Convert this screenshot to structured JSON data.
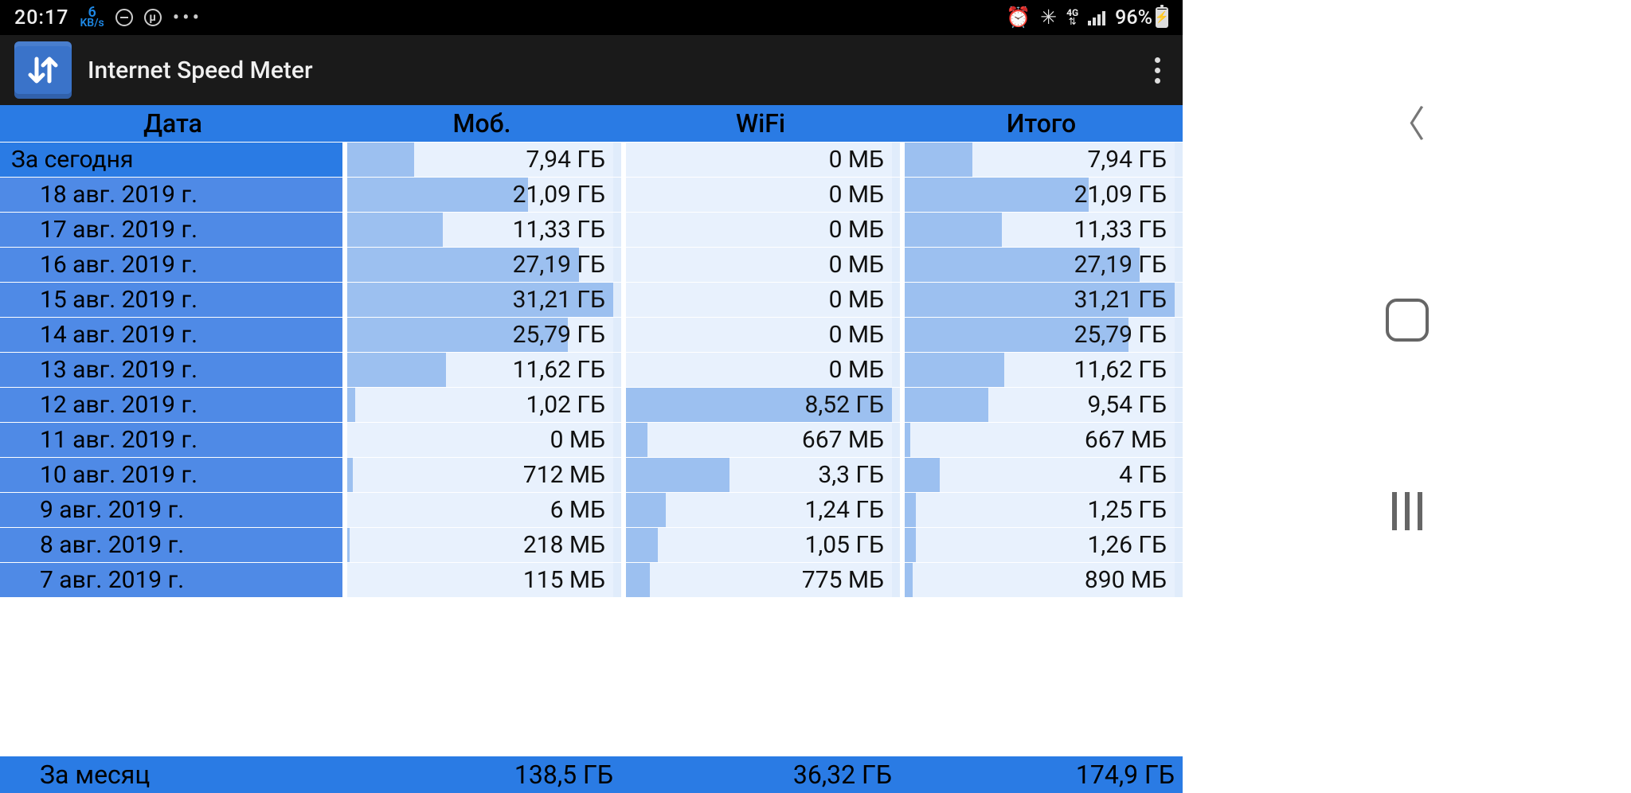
{
  "statusbar": {
    "time": "20:17",
    "kbps_value": "6",
    "kbps_unit": "KB/s",
    "network_type": "4G",
    "battery_text": "96%"
  },
  "appbar": {
    "title": "Internet Speed Meter"
  },
  "table": {
    "headers": {
      "date": "Дата",
      "mobile": "Моб.",
      "wifi": "WiFi",
      "total": "Итого"
    },
    "today_label": "За сегодня",
    "month_label": "За месяц",
    "rows": [
      {
        "date": "За сегодня",
        "mob": "7,94 ГБ",
        "mob_pct": 25,
        "wifi": "0 МБ",
        "wifi_pct": 0,
        "total": "7,94 ГБ",
        "total_pct": 25,
        "special": true
      },
      {
        "date": "18 авг. 2019 г.",
        "mob": "21,09 ГБ",
        "mob_pct": 68,
        "wifi": "0 МБ",
        "wifi_pct": 0,
        "total": "21,09 ГБ",
        "total_pct": 68
      },
      {
        "date": "17 авг. 2019 г.",
        "mob": "11,33 ГБ",
        "mob_pct": 36,
        "wifi": "0 МБ",
        "wifi_pct": 0,
        "total": "11,33 ГБ",
        "total_pct": 36
      },
      {
        "date": "16 авг. 2019 г.",
        "mob": "27,19 ГБ",
        "mob_pct": 87,
        "wifi": "0 МБ",
        "wifi_pct": 0,
        "total": "27,19 ГБ",
        "total_pct": 87
      },
      {
        "date": "15 авг. 2019 г.",
        "mob": "31,21 ГБ",
        "mob_pct": 100,
        "wifi": "0 МБ",
        "wifi_pct": 0,
        "total": "31,21 ГБ",
        "total_pct": 100
      },
      {
        "date": "14 авг. 2019 г.",
        "mob": "25,79 ГБ",
        "mob_pct": 83,
        "wifi": "0 МБ",
        "wifi_pct": 0,
        "total": "25,79 ГБ",
        "total_pct": 83
      },
      {
        "date": "13 авг. 2019 г.",
        "mob": "11,62 ГБ",
        "mob_pct": 37,
        "wifi": "0 МБ",
        "wifi_pct": 0,
        "total": "11,62 ГБ",
        "total_pct": 37
      },
      {
        "date": "12 авг. 2019 г.",
        "mob": "1,02 ГБ",
        "mob_pct": 3,
        "wifi": "8,52 ГБ",
        "wifi_pct": 100,
        "total": "9,54 ГБ",
        "total_pct": 31
      },
      {
        "date": "11 авг. 2019 г.",
        "mob": "0 МБ",
        "mob_pct": 0,
        "wifi": "667 МБ",
        "wifi_pct": 8,
        "total": "667 МБ",
        "total_pct": 2
      },
      {
        "date": "10 авг. 2019 г.",
        "mob": "712 МБ",
        "mob_pct": 2,
        "wifi": "3,3 ГБ",
        "wifi_pct": 39,
        "total": "4 ГБ",
        "total_pct": 13
      },
      {
        "date": "9 авг. 2019 г.",
        "mob": "6 МБ",
        "mob_pct": 0,
        "wifi": "1,24 ГБ",
        "wifi_pct": 15,
        "total": "1,25 ГБ",
        "total_pct": 4
      },
      {
        "date": "8 авг. 2019 г.",
        "mob": "218 МБ",
        "mob_pct": 1,
        "wifi": "1,05 ГБ",
        "wifi_pct": 12,
        "total": "1,26 ГБ",
        "total_pct": 4
      },
      {
        "date": "7 авг. 2019 г.",
        "mob": "115 МБ",
        "mob_pct": 0,
        "wifi": "775 МБ",
        "wifi_pct": 9,
        "total": "890 МБ",
        "total_pct": 3
      }
    ],
    "summary": {
      "mob": "138,5 ГБ",
      "wifi": "36,32 ГБ",
      "total": "174,9 ГБ"
    }
  },
  "chart_data": {
    "type": "bar",
    "title": "Internet Speed Meter — daily data usage",
    "categories": [
      "За сегодня",
      "18 авг. 2019 г.",
      "17 авг. 2019 г.",
      "16 авг. 2019 г.",
      "15 авг. 2019 г.",
      "14 авг. 2019 г.",
      "13 авг. 2019 г.",
      "12 авг. 2019 г.",
      "11 авг. 2019 г.",
      "10 авг. 2019 г.",
      "9 авг. 2019 г.",
      "8 авг. 2019 г.",
      "7 авг. 2019 г."
    ],
    "series": [
      {
        "name": "Моб. (ГБ)",
        "values": [
          7.94,
          21.09,
          11.33,
          27.19,
          31.21,
          25.79,
          11.62,
          1.02,
          0,
          0.7,
          0.006,
          0.21,
          0.11
        ]
      },
      {
        "name": "WiFi (ГБ)",
        "values": [
          0,
          0,
          0,
          0,
          0,
          0,
          0,
          8.52,
          0.65,
          3.3,
          1.24,
          1.05,
          0.76
        ]
      },
      {
        "name": "Итого (ГБ)",
        "values": [
          7.94,
          21.09,
          11.33,
          27.19,
          31.21,
          25.79,
          11.62,
          9.54,
          0.65,
          4,
          1.25,
          1.26,
          0.87
        ]
      }
    ],
    "summary": {
      "Моб. (ГБ)": 138.5,
      "WiFi (ГБ)": 36.32,
      "Итого (ГБ)": 174.9
    }
  }
}
